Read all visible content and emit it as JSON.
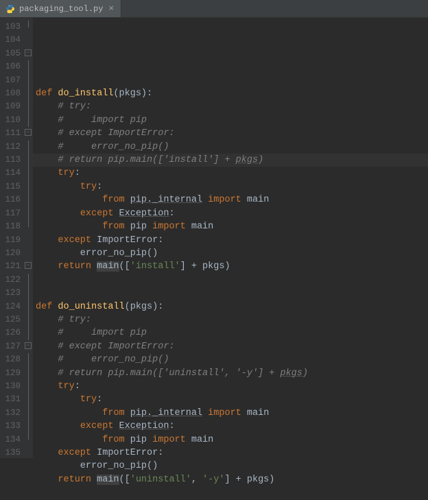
{
  "tab": {
    "filename": "packaging_tool.py",
    "closeGlyph": "×"
  },
  "gutter": {
    "start": 103,
    "end": 135
  },
  "code": {
    "lines": [
      {
        "n": 103,
        "fold": "end",
        "tokens": []
      },
      {
        "n": 104,
        "tokens": []
      },
      {
        "n": 105,
        "fold": "start",
        "tokens": [
          {
            "c": "kw",
            "t": "def "
          },
          {
            "c": "fn",
            "t": "do_install"
          },
          {
            "c": "par",
            "t": "(pkgs):"
          }
        ]
      },
      {
        "n": 106,
        "fold": "line",
        "tokens": [
          {
            "c": "cm",
            "t": "    "
          },
          {
            "c": "cmi",
            "t": "# try:"
          }
        ]
      },
      {
        "n": 107,
        "fold": "line",
        "tokens": [
          {
            "c": "cm",
            "t": "    "
          },
          {
            "c": "cmi",
            "t": "#     import pip"
          }
        ]
      },
      {
        "n": 108,
        "fold": "line",
        "tokens": [
          {
            "c": "cm",
            "t": "    "
          },
          {
            "c": "cmi",
            "t": "# except ImportError:"
          }
        ]
      },
      {
        "n": 109,
        "fold": "line",
        "tokens": [
          {
            "c": "cm",
            "t": "    "
          },
          {
            "c": "cmi",
            "t": "#     error_no_pip()"
          }
        ]
      },
      {
        "n": 110,
        "fold": "line",
        "tokens": [
          {
            "c": "cm",
            "t": "    "
          },
          {
            "c": "cmi",
            "t": "# return pip.main(['install'] + "
          },
          {
            "c": "cmi underline",
            "t": "pkgs"
          },
          {
            "c": "cmi",
            "t": ")"
          }
        ]
      },
      {
        "n": 111,
        "fold": "start",
        "tokens": [
          {
            "c": "par",
            "t": "    "
          },
          {
            "c": "kw",
            "t": "try"
          },
          {
            "c": "par",
            "t": ":"
          }
        ]
      },
      {
        "n": 112,
        "fold": "line",
        "tokens": [
          {
            "c": "par",
            "t": "        "
          },
          {
            "c": "kw",
            "t": "try"
          },
          {
            "c": "par",
            "t": ":"
          }
        ]
      },
      {
        "n": 113,
        "fold": "line",
        "tokens": [
          {
            "c": "par",
            "t": "            "
          },
          {
            "c": "kw",
            "t": "from "
          },
          {
            "c": "par underline",
            "t": "pip._internal"
          },
          {
            "c": "par",
            "t": " "
          },
          {
            "c": "kw",
            "t": "import "
          },
          {
            "c": "par",
            "t": "main"
          }
        ]
      },
      {
        "n": 114,
        "fold": "line",
        "tokens": [
          {
            "c": "par",
            "t": "        "
          },
          {
            "c": "kw",
            "t": "except "
          },
          {
            "c": "par underline",
            "t": "Exception"
          },
          {
            "c": "par",
            "t": ":"
          }
        ]
      },
      {
        "n": 115,
        "fold": "line",
        "tokens": [
          {
            "c": "par",
            "t": "            "
          },
          {
            "c": "kw",
            "t": "from "
          },
          {
            "c": "par",
            "t": "pip "
          },
          {
            "c": "kw",
            "t": "import "
          },
          {
            "c": "par",
            "t": "main"
          }
        ]
      },
      {
        "n": 116,
        "fold": "line",
        "tokens": [
          {
            "c": "par",
            "t": "    "
          },
          {
            "c": "kw",
            "t": "except "
          },
          {
            "c": "par",
            "t": "ImportError:"
          }
        ]
      },
      {
        "n": 117,
        "fold": "line",
        "tokens": [
          {
            "c": "par",
            "t": "        error_no_pip()"
          }
        ]
      },
      {
        "n": 118,
        "fold": "end",
        "tokens": [
          {
            "c": "par",
            "t": "    "
          },
          {
            "c": "kw",
            "t": "return "
          },
          {
            "c": "par hlvar",
            "t": "main"
          },
          {
            "c": "par",
            "t": "(["
          },
          {
            "c": "str",
            "t": "'install'"
          },
          {
            "c": "par",
            "t": "] + pkgs)"
          }
        ]
      },
      {
        "n": 119,
        "tokens": []
      },
      {
        "n": 120,
        "tokens": []
      },
      {
        "n": 121,
        "fold": "start",
        "tokens": [
          {
            "c": "kw",
            "t": "def "
          },
          {
            "c": "fn",
            "t": "do_uninstall"
          },
          {
            "c": "par",
            "t": "(pkgs):"
          }
        ]
      },
      {
        "n": 122,
        "fold": "line",
        "tokens": [
          {
            "c": "cm",
            "t": "    "
          },
          {
            "c": "cmi",
            "t": "# try:"
          }
        ]
      },
      {
        "n": 123,
        "fold": "line",
        "tokens": [
          {
            "c": "cm",
            "t": "    "
          },
          {
            "c": "cmi",
            "t": "#     import pip"
          }
        ]
      },
      {
        "n": 124,
        "fold": "line",
        "tokens": [
          {
            "c": "cm",
            "t": "    "
          },
          {
            "c": "cmi",
            "t": "# except ImportError:"
          }
        ]
      },
      {
        "n": 125,
        "fold": "line",
        "tokens": [
          {
            "c": "cm",
            "t": "    "
          },
          {
            "c": "cmi",
            "t": "#     error_no_pip()"
          }
        ]
      },
      {
        "n": 126,
        "fold": "line",
        "tokens": [
          {
            "c": "cm",
            "t": "    "
          },
          {
            "c": "cmi",
            "t": "# return pip.main(['uninstall', '-y'] + "
          },
          {
            "c": "cmi underline",
            "t": "pkgs"
          },
          {
            "c": "cmi",
            "t": ")"
          }
        ]
      },
      {
        "n": 127,
        "fold": "start",
        "tokens": [
          {
            "c": "par",
            "t": "    "
          },
          {
            "c": "kw",
            "t": "try"
          },
          {
            "c": "par",
            "t": ":"
          }
        ]
      },
      {
        "n": 128,
        "fold": "line",
        "tokens": [
          {
            "c": "par",
            "t": "        "
          },
          {
            "c": "kw",
            "t": "try"
          },
          {
            "c": "par",
            "t": ":"
          }
        ]
      },
      {
        "n": 129,
        "fold": "line",
        "tokens": [
          {
            "c": "par",
            "t": "            "
          },
          {
            "c": "kw",
            "t": "from "
          },
          {
            "c": "par underline",
            "t": "pip._internal"
          },
          {
            "c": "par",
            "t": " "
          },
          {
            "c": "kw",
            "t": "import "
          },
          {
            "c": "par",
            "t": "main"
          }
        ]
      },
      {
        "n": 130,
        "fold": "line",
        "tokens": [
          {
            "c": "par",
            "t": "        "
          },
          {
            "c": "kw",
            "t": "except "
          },
          {
            "c": "par underline",
            "t": "Exception"
          },
          {
            "c": "par",
            "t": ":"
          }
        ]
      },
      {
        "n": 131,
        "fold": "line",
        "tokens": [
          {
            "c": "par",
            "t": "            "
          },
          {
            "c": "kw",
            "t": "from "
          },
          {
            "c": "par",
            "t": "pip "
          },
          {
            "c": "kw",
            "t": "import "
          },
          {
            "c": "par",
            "t": "main"
          }
        ]
      },
      {
        "n": 132,
        "fold": "line",
        "tokens": [
          {
            "c": "par",
            "t": "    "
          },
          {
            "c": "kw",
            "t": "except "
          },
          {
            "c": "par",
            "t": "ImportError:"
          }
        ]
      },
      {
        "n": 133,
        "fold": "line",
        "tokens": [
          {
            "c": "par",
            "t": "        error_no_pip()"
          }
        ]
      },
      {
        "n": 134,
        "fold": "end",
        "tokens": [
          {
            "c": "par",
            "t": "    "
          },
          {
            "c": "kw",
            "t": "return "
          },
          {
            "c": "par hlvar",
            "t": "main"
          },
          {
            "c": "par",
            "t": "(["
          },
          {
            "c": "str",
            "t": "'uninstall'"
          },
          {
            "c": "par",
            "t": ", "
          },
          {
            "c": "str",
            "t": "'-y'"
          },
          {
            "c": "par",
            "t": "] + pkgs)"
          }
        ]
      },
      {
        "n": 135,
        "tokens": []
      }
    ]
  }
}
